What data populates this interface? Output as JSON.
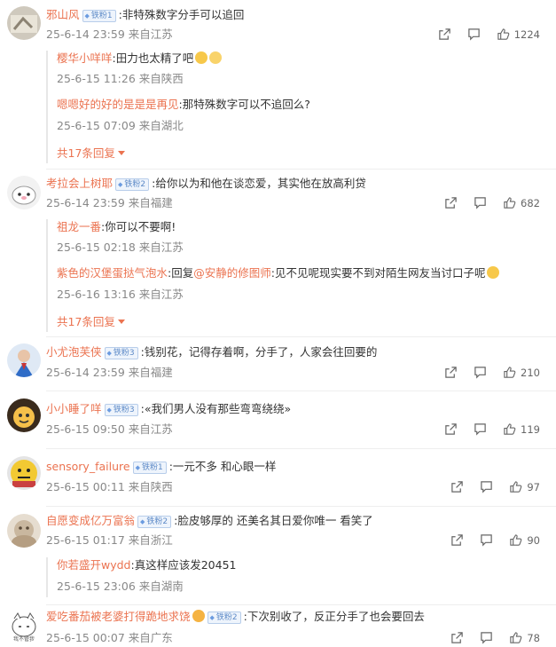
{
  "comments": [
    {
      "user": "邪山风",
      "fan": "铁粉1",
      "text": ":非特殊数字分手可以追回",
      "time": "25-6-14 23:59 来自江苏",
      "likes": "1224",
      "replies": [
        {
          "user": "樱华小咩咩",
          "text": ":田力也太精了吧"
        },
        {
          "meta": "25-6-15 11:26 来自陕西"
        },
        {
          "user": "嗯嗯好的好的是是是再见",
          "text": ":那特殊数字可以不追回么?"
        },
        {
          "meta": "25-6-15 07:09 来自湖北"
        }
      ],
      "more": "共17条回复"
    },
    {
      "user": "考拉会上树耶",
      "fan": "铁粉2",
      "text": ":给你以为和他在谈恋爱，其实他在放高利贷",
      "time": "25-6-14 23:59 来自福建",
      "likes": "682",
      "replies": [
        {
          "user": "祖龙一番",
          "text": ":你可以不要啊!"
        },
        {
          "meta": "25-6-15 02:18 来自江苏"
        },
        {
          "user": "紫色的汉堡蛋挞气泡水",
          "text": ":回复",
          "mention": "@安静的修图师",
          "text2": ":见不见呢现实要不到对陌生网友当讨口子呢"
        },
        {
          "meta": "25-6-16 13:16 来自江苏"
        }
      ],
      "more": "共17条回复"
    },
    {
      "user": "小尤泡芙侠",
      "fan": "铁粉3",
      "text": ":钱别花，记得存着啊，分手了，人家会往回要的",
      "time": "25-6-14 23:59 来自福建",
      "likes": "210"
    },
    {
      "user": "小小睡了咩",
      "fan": "铁粉3",
      "text": ":«我们男人没有那些弯弯绕绕»",
      "time": "25-6-15 09:50 来自江苏",
      "likes": "119"
    },
    {
      "user": "sensory_failure",
      "fan": "铁粉1",
      "text": ":一元不多 和心眼一样",
      "time": "25-6-15 00:11 来自陕西",
      "likes": "97"
    },
    {
      "user": "自愿变成亿万富翁",
      "fan": "铁粉2",
      "text": ":脸皮够厚的 还美名其日爱你唯一 看笑了",
      "time": "25-6-15 01:17 来自浙江",
      "likes": "90",
      "replies": [
        {
          "user": "你若盛开wydd",
          "text": ":真这样应该发20451"
        },
        {
          "meta": "25-6-15 23:06 来自湖南"
        }
      ]
    },
    {
      "user": "爱吃番茄被老婆打得跪地求饶",
      "fan": "铁粉2",
      "text": ":下次别收了，反正分手了也会要回去",
      "time": "25-6-15 00:07 来自广东",
      "likes": "78"
    }
  ],
  "icons": [
    "share-icon",
    "comment-icon",
    "like-icon"
  ],
  "colors": {
    "username": "#eb7350",
    "meta": "#888888",
    "fan_badge": "#5d8ac7"
  }
}
